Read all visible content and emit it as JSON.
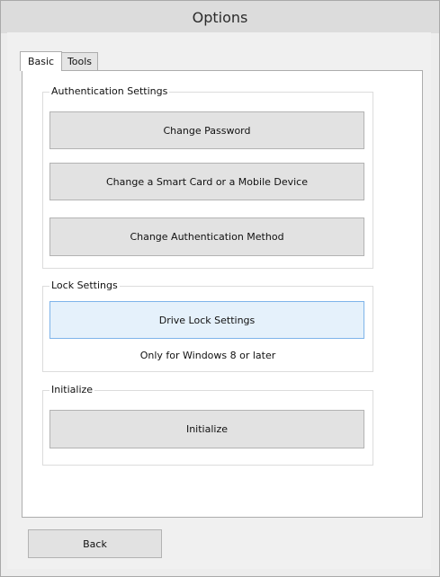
{
  "window": {
    "title": "Options"
  },
  "tabs": [
    {
      "label": "Basic",
      "selected": true
    },
    {
      "label": "Tools",
      "selected": false
    }
  ],
  "groups": {
    "authentication": {
      "label": "Authentication Settings",
      "buttons": [
        "Change Password",
        "Change a Smart Card or a Mobile Device",
        "Change Authentication Method"
      ]
    },
    "lock": {
      "label": "Lock Settings",
      "button": "Drive Lock Settings",
      "note": "Only for Windows 8 or later"
    },
    "initialize": {
      "label": "Initialize",
      "button": "Initialize"
    }
  },
  "footer": {
    "back_label": "Back"
  },
  "colors": {
    "button_face": "#e2e2e2",
    "button_hover": "#e5f1fb",
    "button_hover_border": "#7eb4ea"
  }
}
